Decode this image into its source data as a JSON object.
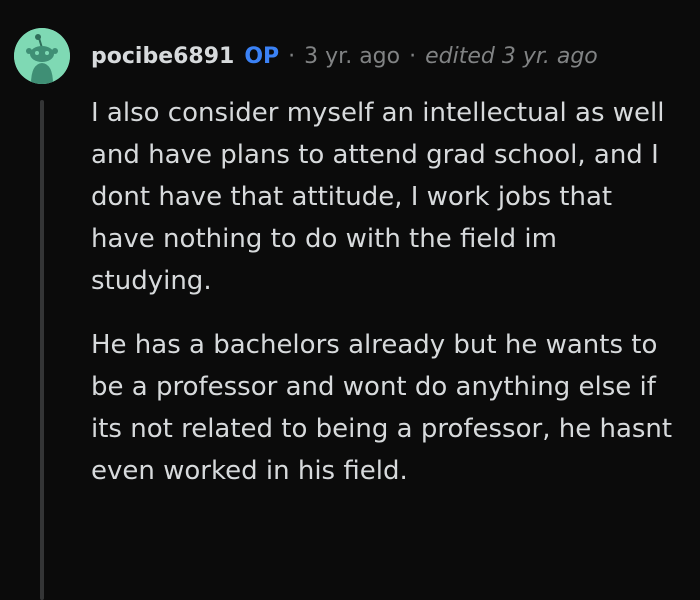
{
  "comment": {
    "username": "pocibe6891",
    "badge": "OP",
    "separator": "·",
    "timestamp": "3 yr. ago",
    "edited": "edited 3 yr. ago",
    "avatar_icon": "snoo-avatar-icon",
    "paragraphs": [
      "I also consider myself an intellectual as well and have plans to attend grad school, and I dont have that attitude, I work jobs that have nothing to do with the field im studying.",
      "He has a bachelors already but he wants to be a professor and wont do anything else if its not related to being a professor, he hasnt even worked in his field."
    ]
  },
  "colors": {
    "background": "#0b0b0b",
    "avatar_bg": "#7fd9b4",
    "text": "#d7dadc",
    "muted": "#818384",
    "op_badge": "#3b82f6",
    "thread_line": "#343536"
  }
}
